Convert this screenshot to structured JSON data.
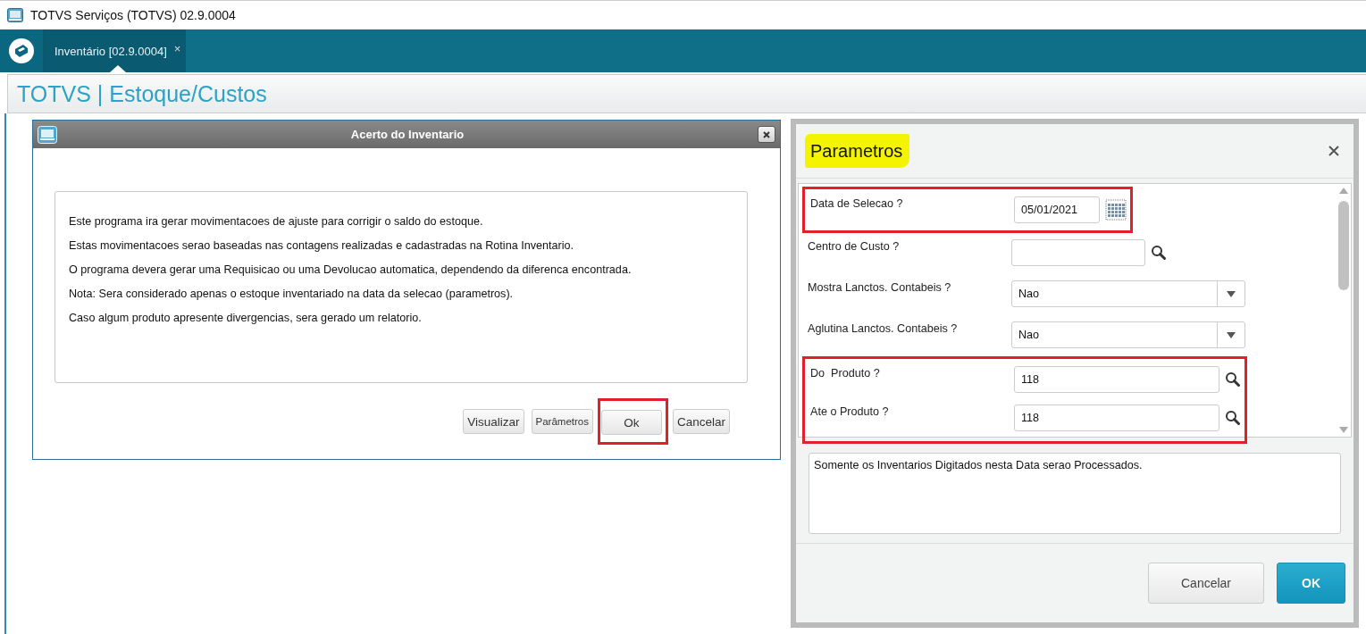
{
  "window": {
    "title": "TOTVS Serviços (TOTVS) 02.9.0004"
  },
  "tabs": [
    {
      "label": "Inventário [02.9.0004]",
      "close": "×",
      "selected": true
    }
  ],
  "header": {
    "title": "TOTVS | Estoque/Custos"
  },
  "dialog": {
    "title": "Acerto do Inventario",
    "lines": [
      "Este programa ira gerar movimentacoes de ajuste para corrigir o saldo do estoque.",
      "Estas movimentacoes serao baseadas nas contagens realizadas e cadastradas na Rotina Inventario.",
      "O programa devera gerar uma Requisicao ou uma Devolucao automatica, dependendo da diferenca encontrada.",
      "Nota: Sera considerado apenas o estoque inventariado na data da selecao (parametros).",
      "Caso algum produto apresente divergencias, sera gerado um relatorio."
    ],
    "buttons": [
      {
        "label": "Visualizar",
        "kind": "normal",
        "outlined": false
      },
      {
        "label": "Parâmetros",
        "kind": "small",
        "outlined": false
      },
      {
        "label": "Ok",
        "kind": "normal",
        "outlined": true
      },
      {
        "label": "Cancelar",
        "kind": "normal",
        "outlined": false
      }
    ]
  },
  "parameters": {
    "title": "Parametros",
    "highlighted": true,
    "groups": [
      {
        "outlined": true,
        "rows": [
          {
            "kind": "date",
            "label": "Data de Selecao ?",
            "value": "05/01/2021"
          }
        ]
      },
      {
        "outlined": false,
        "rows": [
          {
            "kind": "lookup",
            "label": "Centro de Custo ?"
          },
          {
            "kind": "select",
            "label": "Mostra Lanctos. Contabeis ?",
            "value": "Nao"
          },
          {
            "kind": "select",
            "label": "Aglutina Lanctos. Contabeis ?",
            "value": "Nao"
          }
        ]
      },
      {
        "outlined": true,
        "rows": [
          {
            "kind": "wide-lookup",
            "label": "Do  Produto ?",
            "value": "118"
          },
          {
            "kind": "wide-lookup",
            "label": "Ate o Produto ?",
            "value": "118"
          }
        ]
      }
    ],
    "description": "Somente os Inventarios Digitados nesta Data serao Processados.",
    "buttons": [
      {
        "label": "Cancelar",
        "primary": false
      },
      {
        "label": "OK",
        "primary": true
      }
    ]
  }
}
